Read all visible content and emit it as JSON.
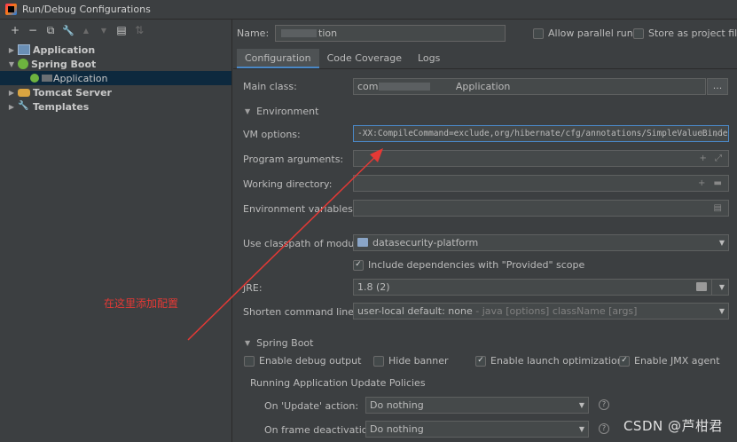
{
  "window": {
    "title": "Run/Debug Configurations"
  },
  "toolbar": {
    "add": "+",
    "remove": "−",
    "copy": "⧉",
    "edit": "🔧",
    "up": "▲",
    "down": "▼",
    "folder": "▤",
    "sort": "⇅"
  },
  "tree": [
    {
      "label": "Application",
      "expanded": false,
      "icon": "application-icon"
    },
    {
      "label": "Spring Boot",
      "expanded": true,
      "icon": "spring-boot-icon"
    },
    {
      "label": "Application",
      "selected": true,
      "icon": "spring-app-icon"
    },
    {
      "label": "Tomcat Server",
      "expanded": false,
      "icon": "tomcat-icon"
    },
    {
      "label": "Templates",
      "expanded": false,
      "icon": "wrench-icon"
    }
  ],
  "header": {
    "name_label": "Name:",
    "name_value": "tion",
    "allow_parallel_label": "Allow parallel run",
    "store_as_file_label": "Store as project file"
  },
  "tabs": [
    "Configuration",
    "Code Coverage",
    "Logs"
  ],
  "config": {
    "main_class_label": "Main class:",
    "main_class_value": "com                         Application",
    "main_class_browse": "...",
    "environment_section": "Environment",
    "vm_options_label": "VM options:",
    "vm_options_value": "-XX:CompileCommand=exclude,org/hibernate/cfg/annotations/SimpleValueBinder.",
    "program_args_label": "Program arguments:",
    "working_dir_label": "Working directory:",
    "env_vars_label": "Environment variables:",
    "classpath_label": "Use classpath of module:",
    "classpath_value": "datasecurity-platform",
    "include_provided_label": "Include dependencies with \"Provided\" scope",
    "jre_label": "JRE:",
    "jre_value": "1.8 (2)",
    "shorten_label": "Shorten command line:",
    "shorten_value": "user-local default: none",
    "shorten_hint": "- java [options] className [args]",
    "spring_boot_section": "Spring Boot",
    "enable_debug_label": "Enable debug output",
    "hide_banner_label": "Hide banner",
    "launch_opt_label": "Enable launch optimization",
    "jmx_label": "Enable JMX agent",
    "policies_title": "Running Application Update Policies",
    "on_update_label": "On 'Update' action:",
    "on_update_value": "Do nothing",
    "on_frame_label": "On frame deactivation:",
    "on_frame_value": "Do nothing"
  },
  "annotation": {
    "text": "在这里添加配置",
    "color": "#e53935"
  },
  "watermark": "CSDN @芦柑君"
}
